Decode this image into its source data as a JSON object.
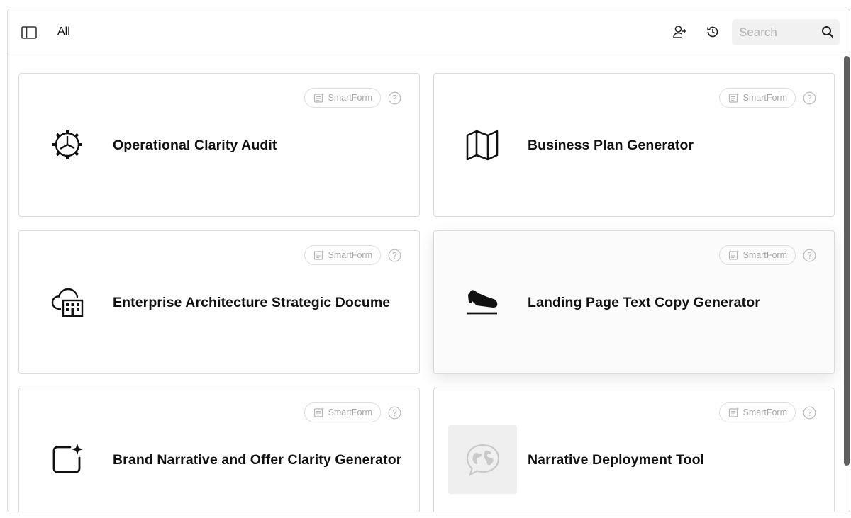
{
  "header": {
    "filter_label": "All",
    "search_placeholder": "Search",
    "search_value": ""
  },
  "cards": [
    {
      "title": "Operational Clarity Audit",
      "badge": "SmartForm",
      "icon": "gear-clock-icon"
    },
    {
      "title": "Business Plan Generator",
      "badge": "SmartForm",
      "icon": "map-icon"
    },
    {
      "title": "Enterprise Architecture Strategic Docume",
      "badge": "SmartForm",
      "icon": "cloud-building-icon"
    },
    {
      "title": "Landing Page Text Copy Generator",
      "badge": "SmartForm",
      "icon": "plane-landing-icon"
    },
    {
      "title": "Brand Narrative and Offer Clarity Generator",
      "badge": "SmartForm",
      "icon": "sparkle-square-icon"
    },
    {
      "title": "Narrative Deployment Tool",
      "badge": "SmartForm",
      "icon": "globe-chat-icon"
    }
  ],
  "colors": {
    "border": "#dadada",
    "muted_text": "#a8a8a8",
    "search_bg": "#f1f1f1",
    "scrollbar": "#5f5f5f"
  }
}
